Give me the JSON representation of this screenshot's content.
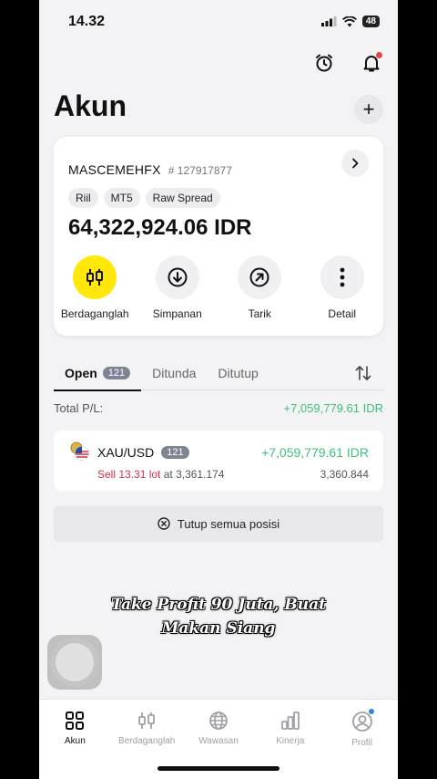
{
  "status_bar": {
    "time": "14.32",
    "battery": "48"
  },
  "header": {
    "title": "Akun",
    "add_label": "+"
  },
  "account": {
    "name": "MASCEMEHFX",
    "number": "# 127917877",
    "tags": [
      "Riil",
      "MT5",
      "Raw Spread"
    ],
    "balance": "64,322,924.06 IDR",
    "actions": [
      {
        "label": "Berdaganglah",
        "icon": "candlestick-icon"
      },
      {
        "label": "Simpanan",
        "icon": "deposit-icon"
      },
      {
        "label": "Tarik",
        "icon": "withdraw-icon"
      },
      {
        "label": "Detail",
        "icon": "more-icon"
      }
    ]
  },
  "tabs": [
    {
      "label": "Open",
      "badge": "121"
    },
    {
      "label": "Ditunda"
    },
    {
      "label": "Ditutup"
    }
  ],
  "total": {
    "label": "Total P/L:",
    "value": "+7,059,779.61 IDR"
  },
  "position": {
    "symbol": "XAU/USD",
    "badge": "121",
    "pl": "+7,059,779.61 IDR",
    "side": "Sell 13.31 lot",
    "at_text": "at 3,361.174",
    "current_price": "3,360.844"
  },
  "close_all_label": "Tutup semua posisi",
  "caption": {
    "line1": "Take Profit 90 Juta, Buat",
    "line2": "Makan Siang"
  },
  "nav": [
    {
      "label": "Akun",
      "icon": "grid-icon"
    },
    {
      "label": "Berdaganglah",
      "icon": "candlestick-icon"
    },
    {
      "label": "Wawasan",
      "icon": "globe-icon"
    },
    {
      "label": "Kinerja",
      "icon": "bar-chart-icon"
    },
    {
      "label": "Profil",
      "icon": "profile-icon"
    }
  ],
  "colors": {
    "accent": "#ffe70a",
    "positive": "#3fbf7f",
    "sell": "#d2314b",
    "badge": "#7d8594"
  }
}
